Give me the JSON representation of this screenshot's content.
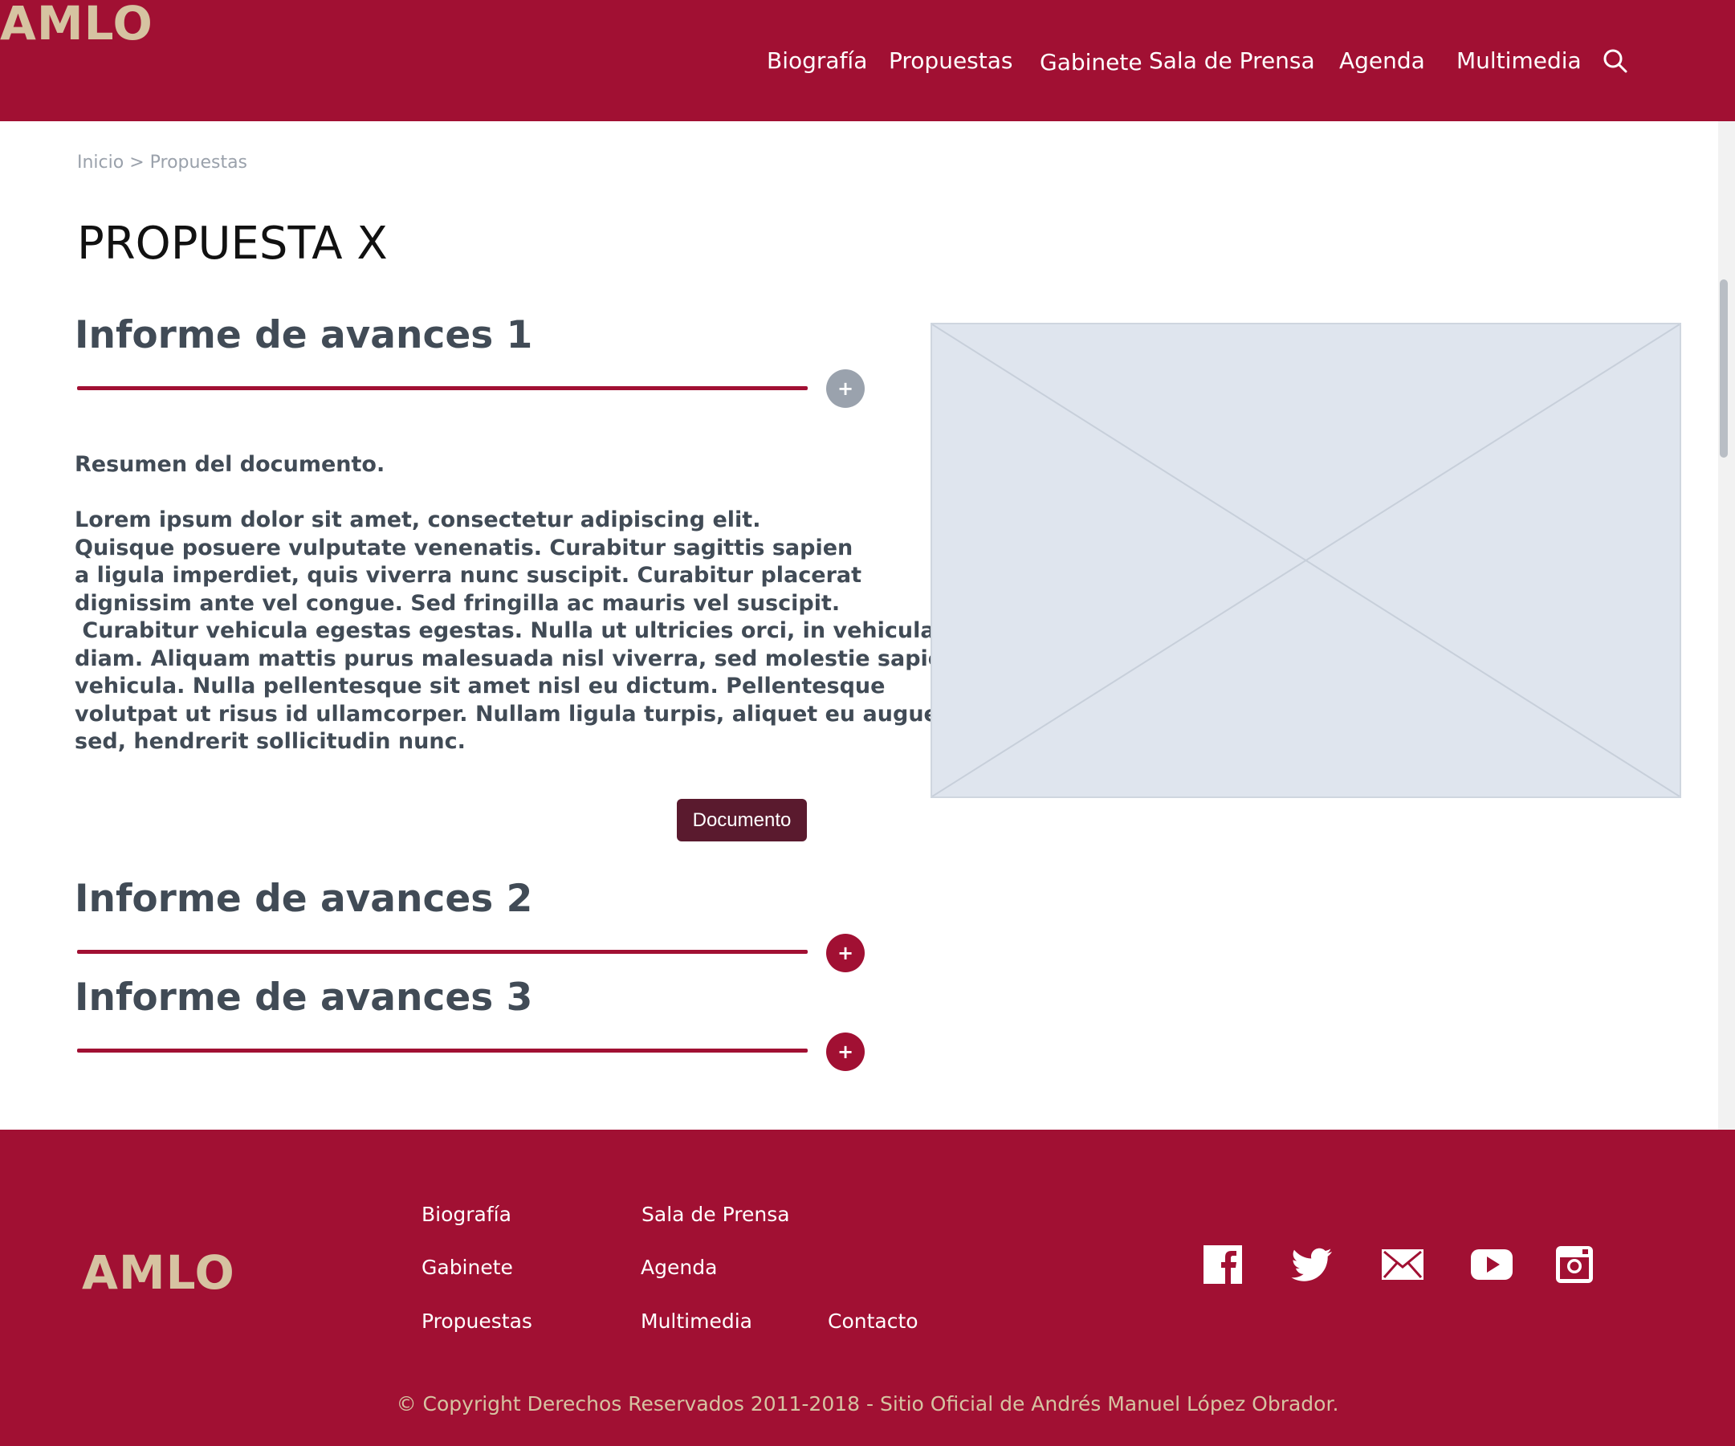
{
  "header": {
    "logo": "AMLO",
    "nav": [
      "Biografía",
      "Propuestas",
      "Gabinete",
      "Sala de Prensa",
      "Agenda",
      "Multimedia"
    ],
    "search_icon": "search-icon"
  },
  "breadcrumb": {
    "home": "Inicio",
    "separator": " > ",
    "current": "Propuestas"
  },
  "page_title": "PROPUESTA X",
  "sections": [
    {
      "title": "Informe de avances 1",
      "toggle": "+",
      "state": "expanded"
    },
    {
      "title": "Informe de avances 2",
      "toggle": "+",
      "state": "collapsed"
    },
    {
      "title": "Informe de avances 3",
      "toggle": "+",
      "state": "collapsed"
    }
  ],
  "content": {
    "summary": "Resumen del documento.",
    "body_lines": [
      "Lorem ipsum dolor sit amet, consectetur adipiscing elit.",
      "Quisque posuere vulputate venenatis. Curabitur sagittis sapien",
      "a ligula imperdiet, quis viverra nunc suscipit. Curabitur placerat",
      "dignissim ante vel congue. Sed fringilla ac mauris vel suscipit.",
      " Curabitur vehicula egestas egestas. Nulla ut ultricies orci, in vehicula",
      "diam. Aliquam mattis purus malesuada nisl viverra, sed molestie sapien",
      "vehicula. Nulla pellentesque sit amet nisl eu dictum. Pellentesque",
      "volutpat ut risus id ullamcorper. Nullam ligula turpis, aliquet eu augue",
      "sed, hendrerit sollicitudin nunc."
    ],
    "document_button": "Documento"
  },
  "footer": {
    "logo": "AMLO",
    "links": {
      "col1": [
        "Biografía",
        "Gabinete",
        "Propuestas"
      ],
      "col2": [
        "Sala de Prensa",
        "Agenda",
        "Multimedia"
      ],
      "col3": [
        "Contacto"
      ]
    },
    "social_icons": [
      "facebook-icon",
      "twitter-icon",
      "email-icon",
      "youtube-icon",
      "instagram-icon"
    ],
    "copyright": "© Copyright Derechos Reservados 2011-2018 - Sitio Oficial de Andrés Manuel López Obrador."
  },
  "colors": {
    "brand": "#a11033",
    "logo": "#d6c3a1",
    "text": "#414b56",
    "button": "#5a1a2e",
    "toggle_open": "#9aa2ad",
    "placeholder": "#dfe5ee"
  }
}
